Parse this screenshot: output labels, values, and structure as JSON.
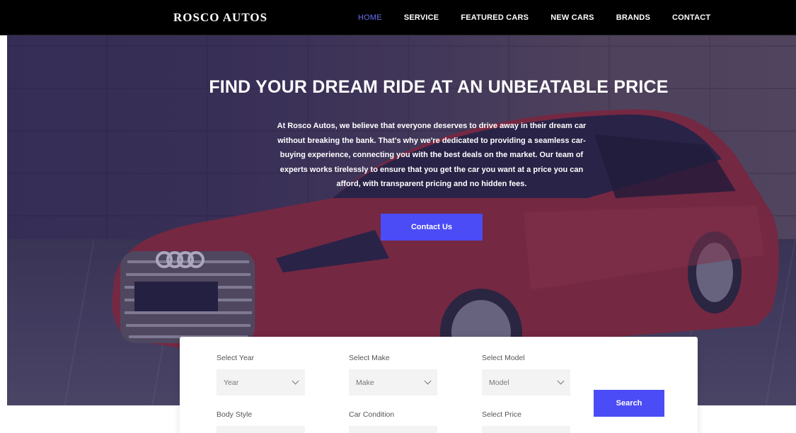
{
  "brand": "ROSCO AUTOS",
  "nav": {
    "items": [
      {
        "label": "HOME",
        "active": true
      },
      {
        "label": "SERVICE"
      },
      {
        "label": "FEATURED CARS"
      },
      {
        "label": "NEW CARS"
      },
      {
        "label": "BRANDS"
      },
      {
        "label": "CONTACT"
      }
    ]
  },
  "hero": {
    "title": "FIND YOUR DREAM RIDE AT AN UNBEATABLE PRICE",
    "text": "At Rosco Autos, we believe that everyone deserves to drive away in their dream car without breaking the bank. That's why we're dedicated to providing a seamless car-buying experience, connecting you with the best deals on the market. Our team of experts works tirelessly to ensure that you get the car you want at a price you can afford, with transparent pricing and no hidden fees.",
    "cta": "Contact Us"
  },
  "search": {
    "fields": [
      {
        "label": "Select Year",
        "value": "Year"
      },
      {
        "label": "Select Make",
        "value": "Make"
      },
      {
        "label": "Select Model",
        "value": "Model"
      },
      {
        "label": "Body Style",
        "value": ""
      },
      {
        "label": "Car Condition",
        "value": ""
      },
      {
        "label": "Select Price",
        "value": ""
      }
    ],
    "button": "Search"
  },
  "colors": {
    "accent": "#4b4cf5",
    "nav_active": "#6b6ff0",
    "nav_bg": "#000000"
  }
}
